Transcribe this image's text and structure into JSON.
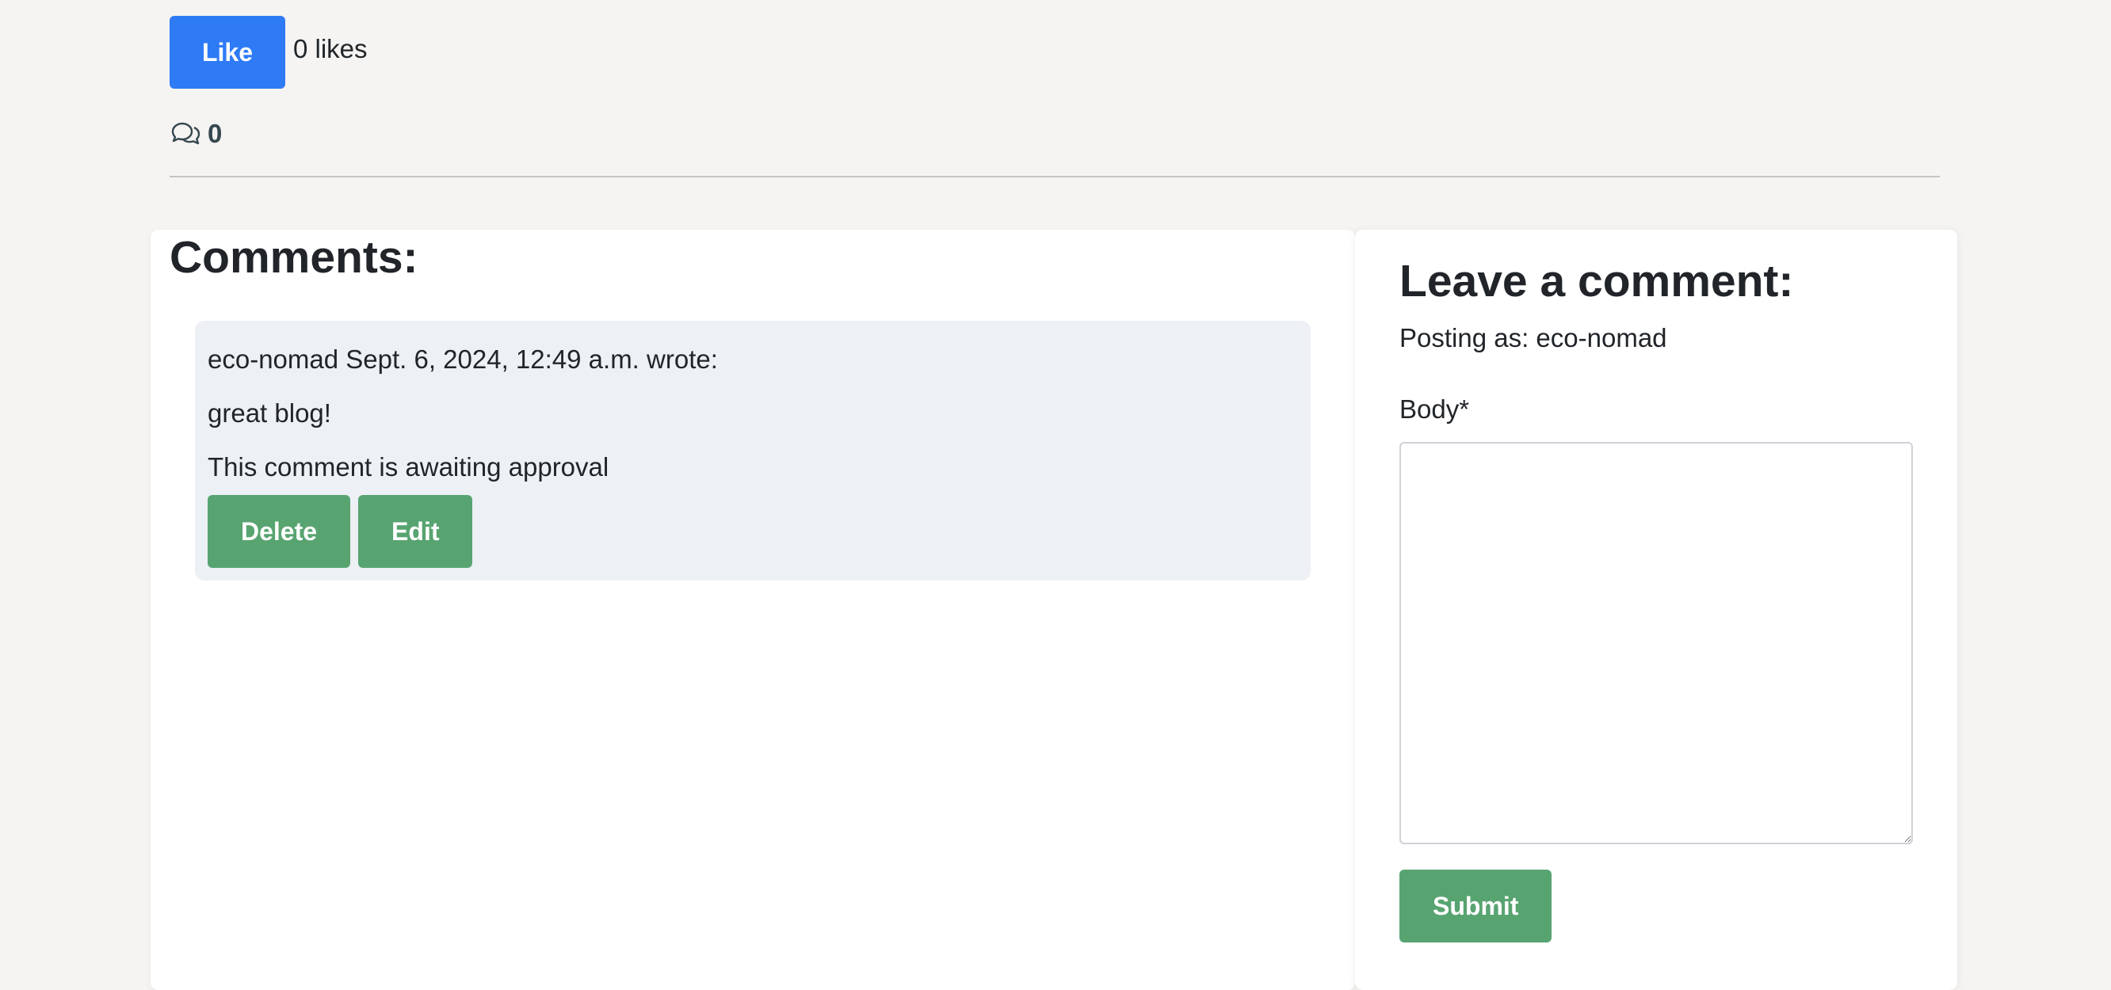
{
  "like": {
    "button_label": "Like",
    "count_text": "0 likes"
  },
  "comments_summary": {
    "icon": "comments-icon",
    "count": "0"
  },
  "comments": {
    "title": "Comments:",
    "items": [
      {
        "meta": "eco-nomad Sept. 6, 2024, 12:49 a.m. wrote:",
        "body": "great blog!",
        "status": "This comment is awaiting approval",
        "delete_label": "Delete",
        "edit_label": "Edit"
      }
    ]
  },
  "leave_comment": {
    "title": "Leave a comment:",
    "posting_as": "Posting as: eco-nomad",
    "body_label": "Body*",
    "body_value": "",
    "submit_label": "Submit"
  },
  "colors": {
    "page_background": "#f5f4f2",
    "like_button": "#2f7bf6",
    "action_button": "#58a471",
    "comment_box": "#edf0f4"
  }
}
